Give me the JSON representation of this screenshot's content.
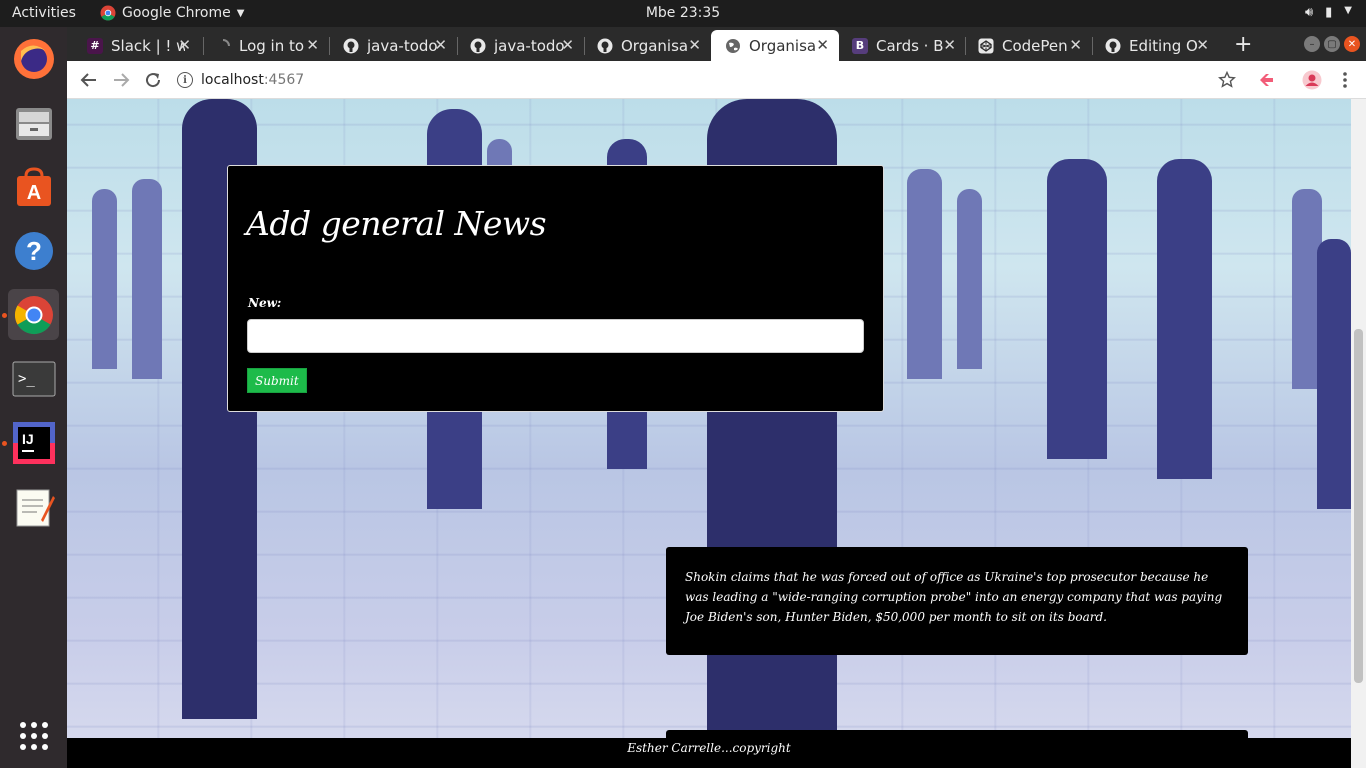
{
  "topbar": {
    "activities": "Activities",
    "app_name": "Google Chrome",
    "clock": "Mbe 23:35"
  },
  "dock": {
    "apps": [
      "firefox-icon",
      "files-icon",
      "software-center-icon",
      "help-icon",
      "chrome-icon",
      "terminal-icon",
      "intellij-icon",
      "text-editor-icon",
      "app-grid-icon"
    ]
  },
  "browser": {
    "tabs": [
      {
        "title": "Slack | ! w",
        "icon": "slack-icon",
        "color": "#4a154b"
      },
      {
        "title": "Log in to",
        "icon": "loading-icon",
        "color": "#2b2b2b"
      },
      {
        "title": "java-todo",
        "icon": "github-icon",
        "color": "#2b2b2b"
      },
      {
        "title": "java-todo",
        "icon": "github-icon",
        "color": "#2b2b2b"
      },
      {
        "title": "Organisa",
        "icon": "github-icon",
        "color": "#2b2b2b"
      },
      {
        "title": "Organisa",
        "icon": "globe-icon",
        "color": "#ffffff"
      },
      {
        "title": "Cards · B",
        "icon": "bootstrap-icon",
        "color": "#563d7c"
      },
      {
        "title": "CodePen",
        "icon": "codepen-icon",
        "color": "#2b2b2b"
      },
      {
        "title": "Editing O",
        "icon": "github-icon",
        "color": "#2b2b2b"
      }
    ],
    "address": {
      "host": "localhost",
      "port": ":4567"
    }
  },
  "page": {
    "form": {
      "heading": "Add general News",
      "label": "New:",
      "input_value": "",
      "submit_label": "Submit"
    },
    "news": [
      {
        "text": "Shokin claims that he was forced out of office as Ukraine's top prosecutor because he was leading a \"wide-ranging corruption probe\" into an energy company that was paying Joe Biden's son, Hunter Biden, $50,000 per month to sit on its board."
      }
    ],
    "footer": "Esther Carrelle...copyright"
  }
}
